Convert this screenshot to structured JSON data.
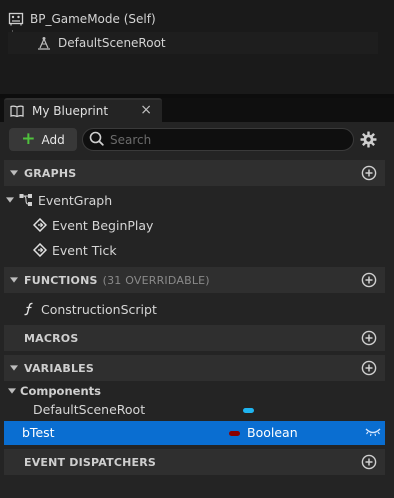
{
  "components": {
    "root_label": "BP_GameMode (Self)",
    "child_label": "DefaultSceneRoot"
  },
  "tab": {
    "title": "My Blueprint",
    "close_glyph": "×"
  },
  "toolbar": {
    "add_label": "Add",
    "search_placeholder": "Search"
  },
  "sections": {
    "graphs": {
      "label": "GRAPHS"
    },
    "functions": {
      "label": "FUNCTIONS",
      "sub": "(31 OVERRIDABLE)"
    },
    "macros": {
      "label": "MACROS"
    },
    "variables": {
      "label": "VARIABLES"
    },
    "dispatchers": {
      "label": "EVENT DISPATCHERS"
    }
  },
  "graphs": {
    "event_graph": "EventGraph",
    "events": [
      "Event BeginPlay",
      "Event Tick"
    ]
  },
  "functions": {
    "items": [
      "ConstructionScript"
    ]
  },
  "variables": {
    "category": "Components",
    "component_var": "DefaultSceneRoot",
    "selected_var": "bTest",
    "selected_type": "Boolean"
  },
  "colors": {
    "selection": "#0a6ed1",
    "object_pin": "#1fb4f0",
    "boolean_pin": "#8c0000",
    "add_plus": "#4fc23d"
  },
  "icons": {
    "blueprint_root": "blueprint-actor-icon",
    "scene_root": "scene-component-icon",
    "tab": "book-icon",
    "search": "search-icon",
    "settings": "gear-icon",
    "graph": "event-graph-icon",
    "event": "event-node-icon",
    "function": "function-icon",
    "visibility": "eye-closed-icon"
  }
}
